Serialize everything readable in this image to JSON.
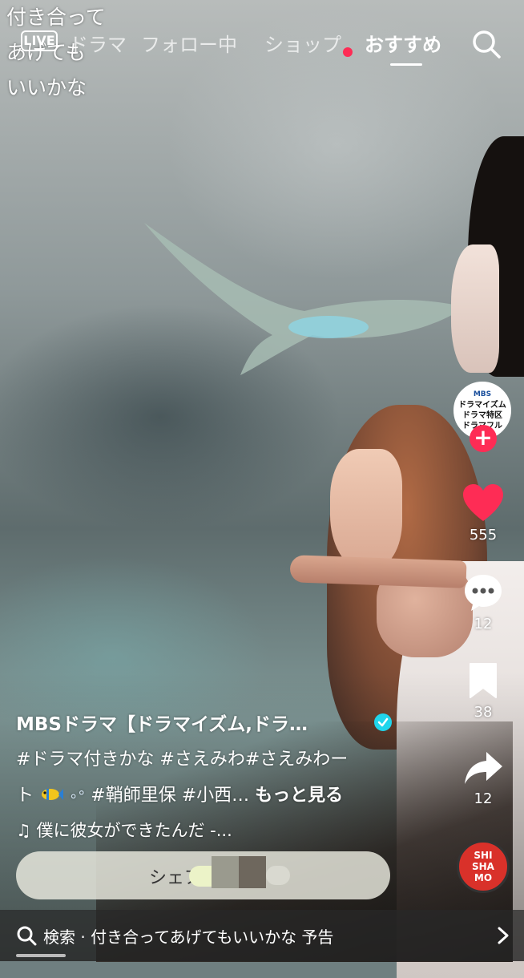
{
  "overlay_caption": [
    "付き合って",
    "あげても",
    "いいかな"
  ],
  "nav": {
    "live_label": "LIVE",
    "tabs": [
      "ドラマ",
      "フォロー中",
      "ショップ",
      "おすすめ"
    ],
    "active_tab": "おすすめ",
    "notification_dot_on": "ショップ",
    "search_icon": "search-icon"
  },
  "creator": {
    "avatar_lines": [
      "MBS",
      "ドラマイズム",
      "ドラマ特区",
      "ドラマフル"
    ],
    "follow_symbol": "+"
  },
  "actions": {
    "likes": "555",
    "comments": "12",
    "saves": "38",
    "shares": "12"
  },
  "music_disc_text": [
    "SHI",
    "SHA",
    "MO"
  ],
  "post": {
    "author": "MBSドラマ【ドラマイズム,ドラ…",
    "desc_line1": "#ドラマ付きかな  #さえみわ#さえみわー",
    "desc_line2_start": "ト",
    "desc_line2_rest": " #鞘師里保 #小西… ",
    "see_more": "もっと見る",
    "music": "♫ 僕に彼女ができたんだ -..."
  },
  "share": {
    "label": "シェア"
  },
  "bottom_search": {
    "text": "検索 · 付き合ってあげてもいいかな 予告"
  },
  "colors": {
    "accent": "#fe2c55",
    "verified": "#20d5ec",
    "like_heart": "#fe2c55"
  }
}
